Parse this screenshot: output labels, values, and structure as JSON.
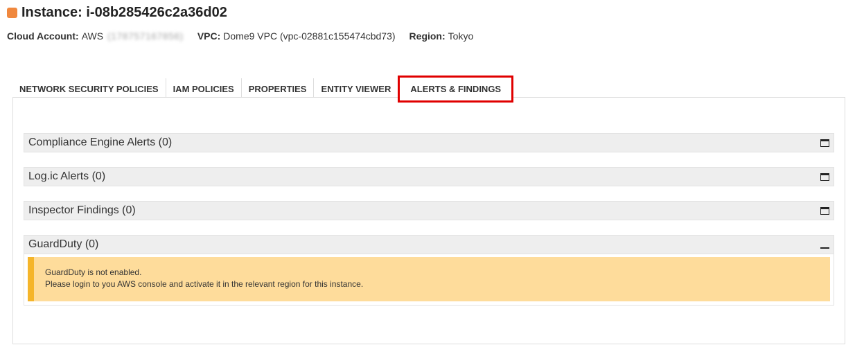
{
  "header": {
    "title": "Instance: i-08b285426c2a36d02",
    "cloud_account_label": "Cloud Account:",
    "cloud_account_value": "AWS",
    "cloud_account_blurred": "(178757167856)",
    "vpc_label": "VPC:",
    "vpc_value": "Dome9 VPC (vpc-02881c155474cbd73)",
    "region_label": "Region:",
    "region_value": "Tokyo",
    "icon_color": "#f0883e"
  },
  "tabs": [
    {
      "label": "NETWORK SECURITY POLICIES",
      "active": false
    },
    {
      "label": "IAM POLICIES",
      "active": false
    },
    {
      "label": "PROPERTIES",
      "active": false
    },
    {
      "label": "ENTITY VIEWER",
      "active": false
    },
    {
      "label": "ALERTS & FINDINGS",
      "active": true
    }
  ],
  "sections": [
    {
      "title": "Compliance Engine Alerts (0)",
      "expanded": false,
      "icon": "window-maximize-icon"
    },
    {
      "title": "Log.ic Alerts (0)",
      "expanded": false,
      "icon": "window-maximize-icon"
    },
    {
      "title": "Inspector Findings (0)",
      "expanded": false,
      "icon": "window-maximize-icon"
    },
    {
      "title": "GuardDuty (0)",
      "expanded": true,
      "icon": "minimize-icon"
    }
  ],
  "guardduty_warning": {
    "line1": "GuardDuty is not enabled.",
    "line2": "Please login to you AWS console and activate it in the relevant region for this instance."
  },
  "colors": {
    "active_tab_border": "#e00000",
    "warning_background": "#fedc9b",
    "warning_accent": "#f5b52a"
  }
}
